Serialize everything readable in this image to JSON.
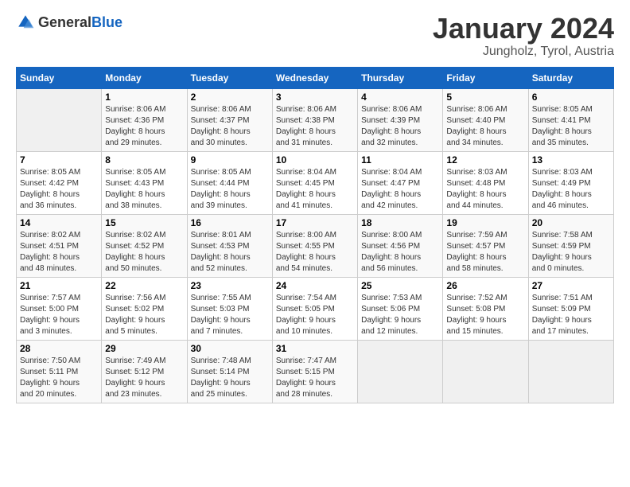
{
  "header": {
    "logo_general": "General",
    "logo_blue": "Blue",
    "title": "January 2024",
    "subtitle": "Jungholz, Tyrol, Austria"
  },
  "columns": [
    "Sunday",
    "Monday",
    "Tuesday",
    "Wednesday",
    "Thursday",
    "Friday",
    "Saturday"
  ],
  "weeks": [
    [
      {
        "day": "",
        "info": ""
      },
      {
        "day": "1",
        "info": "Sunrise: 8:06 AM\nSunset: 4:36 PM\nDaylight: 8 hours\nand 29 minutes."
      },
      {
        "day": "2",
        "info": "Sunrise: 8:06 AM\nSunset: 4:37 PM\nDaylight: 8 hours\nand 30 minutes."
      },
      {
        "day": "3",
        "info": "Sunrise: 8:06 AM\nSunset: 4:38 PM\nDaylight: 8 hours\nand 31 minutes."
      },
      {
        "day": "4",
        "info": "Sunrise: 8:06 AM\nSunset: 4:39 PM\nDaylight: 8 hours\nand 32 minutes."
      },
      {
        "day": "5",
        "info": "Sunrise: 8:06 AM\nSunset: 4:40 PM\nDaylight: 8 hours\nand 34 minutes."
      },
      {
        "day": "6",
        "info": "Sunrise: 8:05 AM\nSunset: 4:41 PM\nDaylight: 8 hours\nand 35 minutes."
      }
    ],
    [
      {
        "day": "7",
        "info": "Sunrise: 8:05 AM\nSunset: 4:42 PM\nDaylight: 8 hours\nand 36 minutes."
      },
      {
        "day": "8",
        "info": "Sunrise: 8:05 AM\nSunset: 4:43 PM\nDaylight: 8 hours\nand 38 minutes."
      },
      {
        "day": "9",
        "info": "Sunrise: 8:05 AM\nSunset: 4:44 PM\nDaylight: 8 hours\nand 39 minutes."
      },
      {
        "day": "10",
        "info": "Sunrise: 8:04 AM\nSunset: 4:45 PM\nDaylight: 8 hours\nand 41 minutes."
      },
      {
        "day": "11",
        "info": "Sunrise: 8:04 AM\nSunset: 4:47 PM\nDaylight: 8 hours\nand 42 minutes."
      },
      {
        "day": "12",
        "info": "Sunrise: 8:03 AM\nSunset: 4:48 PM\nDaylight: 8 hours\nand 44 minutes."
      },
      {
        "day": "13",
        "info": "Sunrise: 8:03 AM\nSunset: 4:49 PM\nDaylight: 8 hours\nand 46 minutes."
      }
    ],
    [
      {
        "day": "14",
        "info": "Sunrise: 8:02 AM\nSunset: 4:51 PM\nDaylight: 8 hours\nand 48 minutes."
      },
      {
        "day": "15",
        "info": "Sunrise: 8:02 AM\nSunset: 4:52 PM\nDaylight: 8 hours\nand 50 minutes."
      },
      {
        "day": "16",
        "info": "Sunrise: 8:01 AM\nSunset: 4:53 PM\nDaylight: 8 hours\nand 52 minutes."
      },
      {
        "day": "17",
        "info": "Sunrise: 8:00 AM\nSunset: 4:55 PM\nDaylight: 8 hours\nand 54 minutes."
      },
      {
        "day": "18",
        "info": "Sunrise: 8:00 AM\nSunset: 4:56 PM\nDaylight: 8 hours\nand 56 minutes."
      },
      {
        "day": "19",
        "info": "Sunrise: 7:59 AM\nSunset: 4:57 PM\nDaylight: 8 hours\nand 58 minutes."
      },
      {
        "day": "20",
        "info": "Sunrise: 7:58 AM\nSunset: 4:59 PM\nDaylight: 9 hours\nand 0 minutes."
      }
    ],
    [
      {
        "day": "21",
        "info": "Sunrise: 7:57 AM\nSunset: 5:00 PM\nDaylight: 9 hours\nand 3 minutes."
      },
      {
        "day": "22",
        "info": "Sunrise: 7:56 AM\nSunset: 5:02 PM\nDaylight: 9 hours\nand 5 minutes."
      },
      {
        "day": "23",
        "info": "Sunrise: 7:55 AM\nSunset: 5:03 PM\nDaylight: 9 hours\nand 7 minutes."
      },
      {
        "day": "24",
        "info": "Sunrise: 7:54 AM\nSunset: 5:05 PM\nDaylight: 9 hours\nand 10 minutes."
      },
      {
        "day": "25",
        "info": "Sunrise: 7:53 AM\nSunset: 5:06 PM\nDaylight: 9 hours\nand 12 minutes."
      },
      {
        "day": "26",
        "info": "Sunrise: 7:52 AM\nSunset: 5:08 PM\nDaylight: 9 hours\nand 15 minutes."
      },
      {
        "day": "27",
        "info": "Sunrise: 7:51 AM\nSunset: 5:09 PM\nDaylight: 9 hours\nand 17 minutes."
      }
    ],
    [
      {
        "day": "28",
        "info": "Sunrise: 7:50 AM\nSunset: 5:11 PM\nDaylight: 9 hours\nand 20 minutes."
      },
      {
        "day": "29",
        "info": "Sunrise: 7:49 AM\nSunset: 5:12 PM\nDaylight: 9 hours\nand 23 minutes."
      },
      {
        "day": "30",
        "info": "Sunrise: 7:48 AM\nSunset: 5:14 PM\nDaylight: 9 hours\nand 25 minutes."
      },
      {
        "day": "31",
        "info": "Sunrise: 7:47 AM\nSunset: 5:15 PM\nDaylight: 9 hours\nand 28 minutes."
      },
      {
        "day": "",
        "info": ""
      },
      {
        "day": "",
        "info": ""
      },
      {
        "day": "",
        "info": ""
      }
    ]
  ]
}
